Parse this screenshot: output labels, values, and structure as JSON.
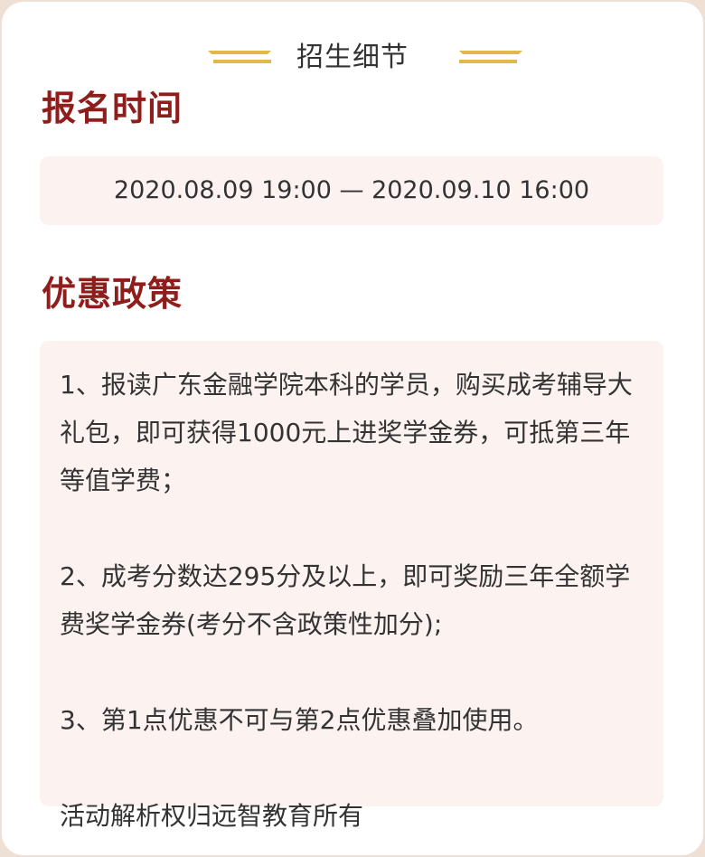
{
  "header": {
    "title": "招生细节"
  },
  "registration": {
    "heading": "报名时间",
    "period": "2020.08.09 19:00 — 2020.09.10 16:00"
  },
  "policy": {
    "heading": "优惠政策",
    "items": [
      "1、报读广东金融学院本科的学员，购买成考辅导大礼包，即可获得1000元上进奖学金券，可抵第三年等值学费；",
      "2、成考分数达295分及以上，即可奖励三年全额学费奖学金券(考分不含政策性加分);",
      "3、第1点优惠不可与第2点优惠叠加使用。"
    ],
    "footer": "活动解析权归远智教育所有"
  },
  "colors": {
    "heading": "#8e1d1b",
    "deco_gold": "#e3b84a",
    "box_background": "#fcf3f1",
    "page_background": "#efe0d6"
  },
  "icons": {
    "header_left": "gold-double-line-decoration-icon",
    "header_right": "gold-double-line-decoration-icon"
  }
}
